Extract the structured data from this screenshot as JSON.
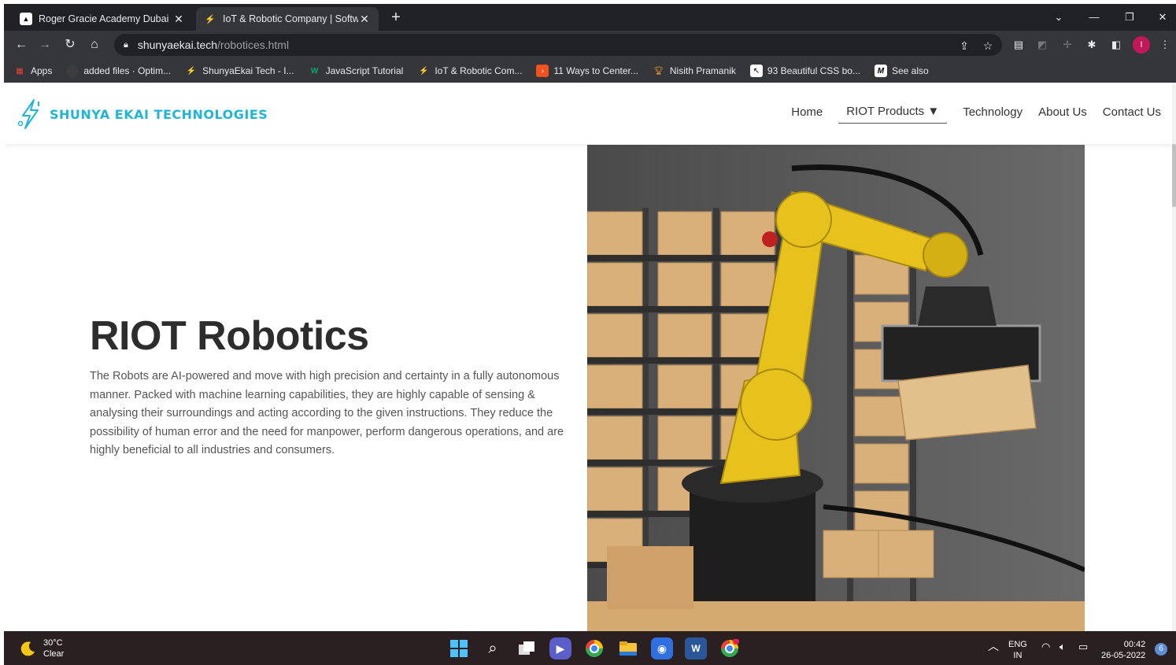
{
  "browser": {
    "tabs": [
      {
        "title": "Roger Gracie Academy Dubai",
        "active": false
      },
      {
        "title": "IoT & Robotic Company | Softwar",
        "active": true
      }
    ],
    "new_tab_label": "+",
    "url_host": "shunyaekai.tech",
    "url_path": "/robotices.html",
    "profile_initial": "I",
    "bookmarks": [
      {
        "label": "Apps",
        "icon": "apps-grid-icon"
      },
      {
        "label": "added files · Optim...",
        "icon": "github-icon"
      },
      {
        "label": "ShunyaEkai Tech - I...",
        "icon": "shunya-icon"
      },
      {
        "label": "JavaScript Tutorial",
        "icon": "w3-icon"
      },
      {
        "label": "IoT & Robotic Com...",
        "icon": "shunya-icon"
      },
      {
        "label": "11 Ways to Center...",
        "icon": "orange-icon"
      },
      {
        "label": "Nisith Pramanik",
        "icon": "trophy-icon"
      },
      {
        "label": "93 Beautiful CSS bo...",
        "icon": "cursor-icon"
      },
      {
        "label": "See also",
        "icon": "m-icon"
      }
    ]
  },
  "site": {
    "brand": "SHUNYA EKAI TECHNOLOGIES",
    "brand_color": "#1fb5d6",
    "nav": [
      {
        "label": "Home"
      },
      {
        "label": "RIOT Products ▼",
        "active": true
      },
      {
        "label": "Technology"
      },
      {
        "label": "About Us"
      },
      {
        "label": "Contact Us"
      }
    ]
  },
  "hero": {
    "title": "RIOT Robotics",
    "description": "The Robots are AI-powered and move with high precision and certainty in a fully autonomous manner. Packed with machine learning capabilities, they are highly capable of sensing & analysing their surroundings and acting according to the given instructions. They reduce the possibility of human error and the need for manpower, perform dangerous operations, and are highly beneficial to all industries and consumers."
  },
  "taskbar": {
    "temperature": "30°C",
    "weather": "Clear",
    "lang_top": "ENG",
    "lang_bottom": "IN",
    "time": "00:42",
    "date": "26-05-2022",
    "notification_count": "6"
  }
}
